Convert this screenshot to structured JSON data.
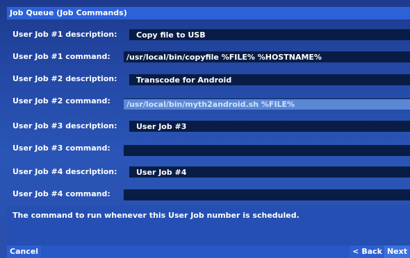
{
  "window": {
    "title": "Job Queue (Job Commands)"
  },
  "rows": [
    {
      "label": "User Job #1 description:",
      "value": "Copy file to USB"
    },
    {
      "label": "User Job #1 command:",
      "value": "/usr/local/bin/copyfile %FILE% %HOSTNAME%"
    },
    {
      "label": "User Job #2 description:",
      "value": "Transcode for Android"
    },
    {
      "label": "User Job #2 command:",
      "value": "/usr/local/bin/myth2android.sh %FILE%"
    },
    {
      "label": "User Job #3 description:",
      "value": "User Job #3"
    },
    {
      "label": "User Job #3 command:",
      "value": ""
    },
    {
      "label": "User Job #4 description:",
      "value": "User Job #4"
    },
    {
      "label": "User Job #4 command:",
      "value": ""
    }
  ],
  "help": {
    "text": "The command to run whenever this User Job number is scheduled."
  },
  "buttons": {
    "cancel": "Cancel",
    "back": "< Back",
    "next": "Next"
  }
}
